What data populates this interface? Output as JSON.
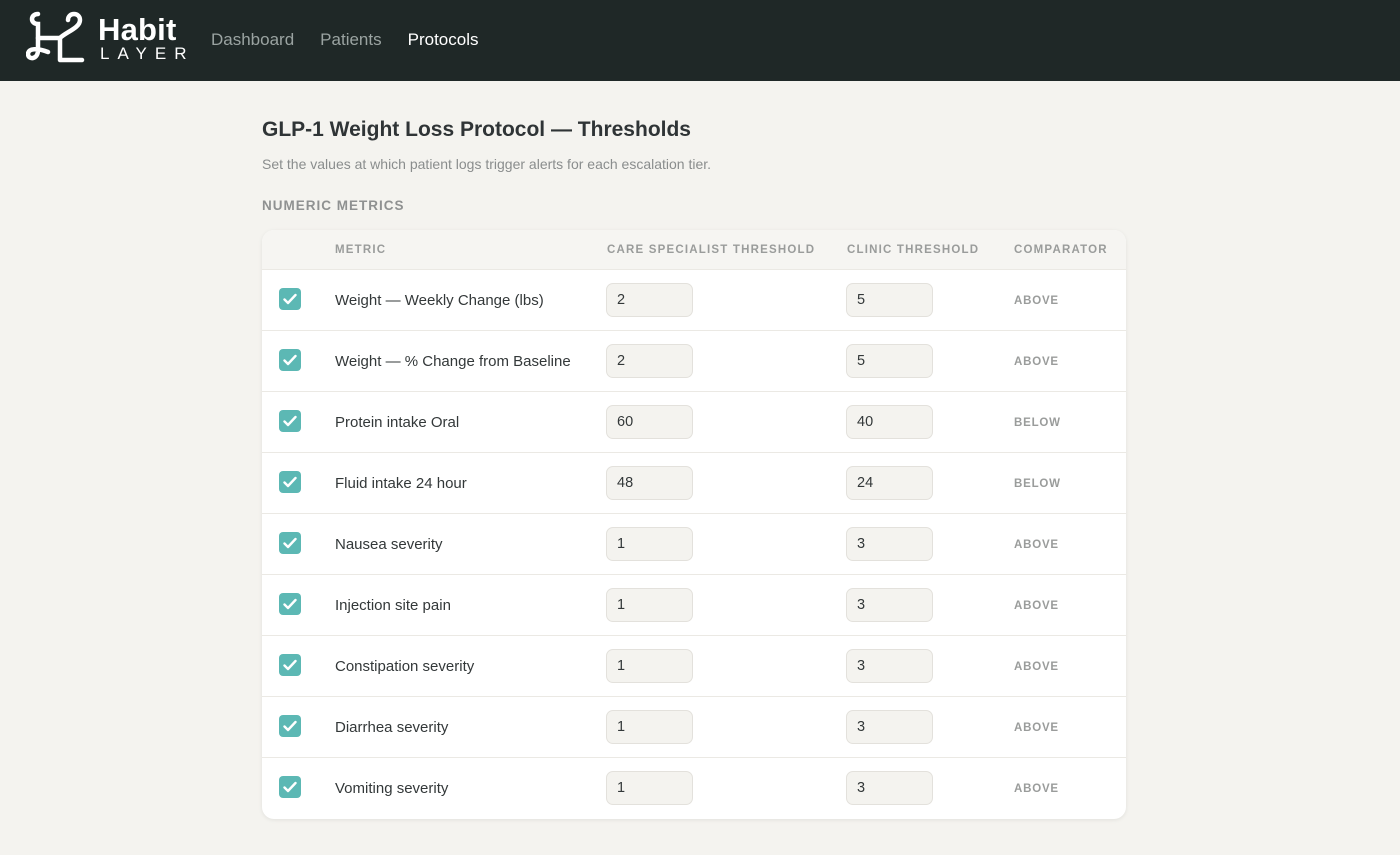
{
  "brand": {
    "name": "Habit",
    "sub": "LAYER"
  },
  "nav": [
    {
      "label": "Dashboard",
      "active": false
    },
    {
      "label": "Patients",
      "active": false
    },
    {
      "label": "Protocols",
      "active": true
    }
  ],
  "page": {
    "title": "GLP-1 Weight Loss Protocol — Thresholds",
    "subtitle": "Set the values at which patient logs trigger alerts for each escalation tier.",
    "section_label": "NUMERIC METRICS"
  },
  "table": {
    "columns": {
      "metric": "METRIC",
      "care_specialist": "CARE SPECIALIST THRESHOLD",
      "clinic": "CLINIC THRESHOLD",
      "comparator": "COMPARATOR"
    },
    "rows": [
      {
        "checked": true,
        "metric": "Weight — Weekly Change (lbs)",
        "care_specialist": "2",
        "clinic": "5",
        "comparator": "ABOVE"
      },
      {
        "checked": true,
        "metric": "Weight — % Change from Baseline",
        "care_specialist": "2",
        "clinic": "5",
        "comparator": "ABOVE"
      },
      {
        "checked": true,
        "metric": "Protein intake Oral",
        "care_specialist": "60",
        "clinic": "40",
        "comparator": "BELOW"
      },
      {
        "checked": true,
        "metric": "Fluid intake 24 hour",
        "care_specialist": "48",
        "clinic": "24",
        "comparator": "BELOW"
      },
      {
        "checked": true,
        "metric": "Nausea severity",
        "care_specialist": "1",
        "clinic": "3",
        "comparator": "ABOVE"
      },
      {
        "checked": true,
        "metric": "Injection site pain",
        "care_specialist": "1",
        "clinic": "3",
        "comparator": "ABOVE"
      },
      {
        "checked": true,
        "metric": "Constipation severity",
        "care_specialist": "1",
        "clinic": "3",
        "comparator": "ABOVE"
      },
      {
        "checked": true,
        "metric": "Diarrhea severity",
        "care_specialist": "1",
        "clinic": "3",
        "comparator": "ABOVE"
      },
      {
        "checked": true,
        "metric": "Vomiting severity",
        "care_specialist": "1",
        "clinic": "3",
        "comparator": "ABOVE"
      }
    ]
  },
  "colors": {
    "topbar": "#1f2827",
    "accent": "#5cb8b4",
    "background": "#f4f3ef"
  },
  "icons": {
    "checkbox": "check-icon",
    "logo": "habit-layer-logo-icon"
  }
}
